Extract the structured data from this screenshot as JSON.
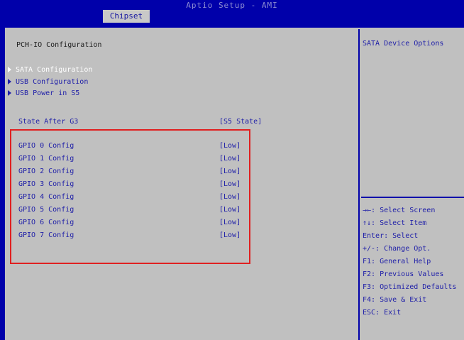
{
  "header": {
    "title": "Aptio Setup - AMI",
    "tab": "Chipset"
  },
  "main": {
    "page_title": "PCH-IO Configuration",
    "submenus": [
      {
        "label": "SATA Configuration",
        "selected": true
      },
      {
        "label": "USB Configuration",
        "selected": false
      },
      {
        "label": "USB Power in S5",
        "selected": false
      }
    ],
    "state_after_g3": {
      "label": "State After G3",
      "value": "[S5 State]"
    },
    "gpio": [
      {
        "label": "GPIO 0 Config",
        "value": "[Low]"
      },
      {
        "label": "GPIO 1 Config",
        "value": "[Low]"
      },
      {
        "label": "GPIO 2 Config",
        "value": "[Low]"
      },
      {
        "label": "GPIO 3 Config",
        "value": "[Low]"
      },
      {
        "label": "GPIO 4 Config",
        "value": "[Low]"
      },
      {
        "label": "GPIO 5 Config",
        "value": "[Low]"
      },
      {
        "label": "GPIO 6 Config",
        "value": "[Low]"
      },
      {
        "label": "GPIO 7 Config",
        "value": "[Low]"
      }
    ]
  },
  "help_panel": {
    "description": "SATA Device Options",
    "keys": [
      "→←: Select Screen",
      "↑↓: Select Item",
      "Enter: Select",
      "+/-: Change Opt.",
      "F1: General Help",
      "F2: Previous Values",
      "F3: Optimized Defaults",
      "F4: Save & Exit",
      "ESC: Exit"
    ]
  },
  "colors": {
    "background": "#0000aa",
    "panel": "#c0c0c0",
    "text": "#2020a8",
    "selected_text": "#ffffff",
    "highlight_box": "#e02020"
  }
}
